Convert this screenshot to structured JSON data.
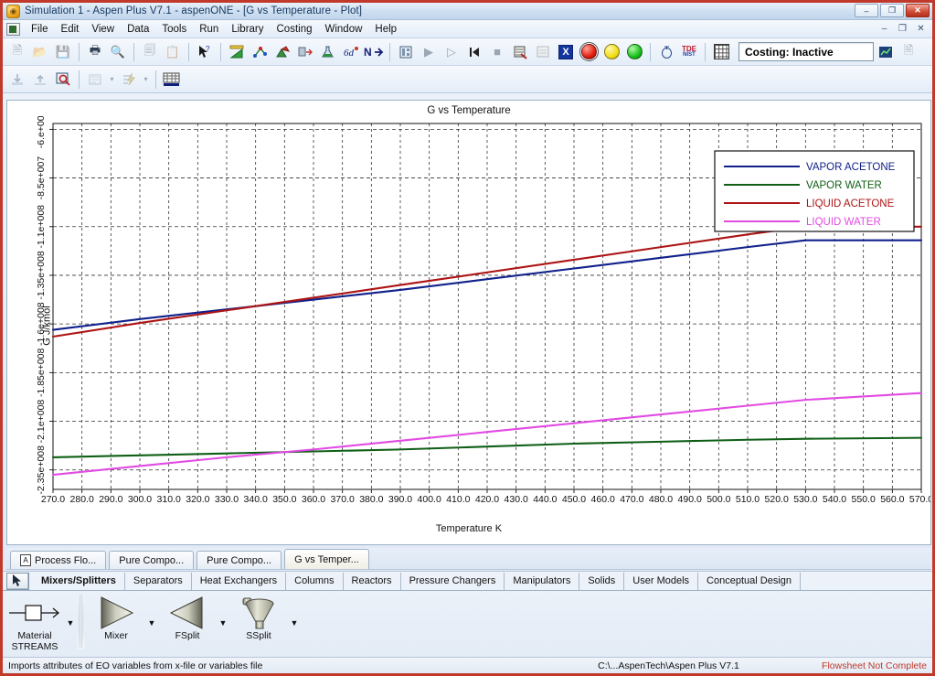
{
  "window": {
    "title": "Simulation 1 - Aspen Plus V7.1 - aspenONE - [G vs Temperature - Plot]",
    "app_icon": "aspen-icon",
    "minimize": "–",
    "maximize": "❐",
    "close": "✕",
    "mdi_minimize": "–",
    "mdi_restore": "❐",
    "mdi_close": "✕"
  },
  "menu": {
    "items": [
      {
        "label": "File"
      },
      {
        "label": "Edit"
      },
      {
        "label": "View"
      },
      {
        "label": "Data"
      },
      {
        "label": "Tools"
      },
      {
        "label": "Run"
      },
      {
        "label": "Library"
      },
      {
        "label": "Costing"
      },
      {
        "label": "Window"
      },
      {
        "label": "Help"
      }
    ]
  },
  "toolbar": {
    "costing_status": "Costing: Inactive",
    "buttons": [
      {
        "name": "new-icon",
        "glyph": "🗎"
      },
      {
        "name": "open-icon",
        "glyph": "📂"
      },
      {
        "name": "save-icon",
        "glyph": "💾"
      },
      {
        "name": "print-icon",
        "glyph": "🖶"
      },
      {
        "name": "print-preview-icon",
        "glyph": "🔍"
      },
      {
        "name": "copy-icon",
        "glyph": "🗐"
      },
      {
        "name": "paste-icon",
        "glyph": "📋"
      },
      {
        "name": "help-pointer-icon",
        "glyph": "❖"
      },
      {
        "name": "plot-wizard-icon",
        "glyph": "📈"
      },
      {
        "name": "stream-table-icon",
        "glyph": "✛"
      },
      {
        "name": "reconcile-icon",
        "glyph": "⛰"
      },
      {
        "name": "data-fit-icon",
        "glyph": "⇥"
      },
      {
        "name": "analysis-icon",
        "glyph": "⚗"
      },
      {
        "name": "binary-analysis-icon",
        "glyph": "6d"
      },
      {
        "name": "next-input-icon",
        "glyph": "N▸"
      },
      {
        "name": "control-panel-icon",
        "glyph": "▤"
      },
      {
        "name": "run-icon",
        "glyph": "▶"
      },
      {
        "name": "step-icon",
        "glyph": "▷"
      },
      {
        "name": "reinitialize-icon",
        "glyph": "◀|"
      },
      {
        "name": "stop-icon",
        "glyph": "■"
      },
      {
        "name": "results-icon",
        "glyph": "▥"
      },
      {
        "name": "report-icon",
        "glyph": "▨"
      },
      {
        "name": "excel-export-icon",
        "glyph": "X"
      },
      {
        "name": "status-red-icon",
        "glyph": ""
      },
      {
        "name": "status-yellow-icon",
        "glyph": ""
      },
      {
        "name": "status-green-icon",
        "glyph": ""
      },
      {
        "name": "properties-icon",
        "glyph": "⌬"
      },
      {
        "name": "tde-nist-icon",
        "glyph": "TDE"
      },
      {
        "name": "grid-icon",
        "glyph": "▦"
      }
    ],
    "row2_buttons": [
      {
        "name": "import-icon",
        "glyph": "⇩"
      },
      {
        "name": "export-icon",
        "glyph": "⇧"
      },
      {
        "name": "zoom-icon",
        "glyph": "🔍"
      },
      {
        "name": "form-icon",
        "glyph": "▤"
      },
      {
        "name": "form-caret-icon",
        "glyph": "▾"
      },
      {
        "name": "lightning-icon",
        "glyph": "⚡"
      },
      {
        "name": "lightning-caret-icon",
        "glyph": "▾"
      },
      {
        "name": "table-view-icon",
        "glyph": "▦"
      }
    ]
  },
  "chart_data": {
    "type": "line",
    "title": "G vs Temperature",
    "xlabel": "Temperature  K",
    "ylabel": "G J/kmol",
    "xlim": [
      270.0,
      570.0
    ],
    "ylim": [
      -245000000,
      -57000000
    ],
    "grid": true,
    "legend_position": "top-right",
    "xticks": [
      "270.0",
      "280.0",
      "290.0",
      "300.0",
      "310.0",
      "320.0",
      "330.0",
      "340.0",
      "350.0",
      "360.0",
      "370.0",
      "380.0",
      "390.0",
      "400.0",
      "410.0",
      "420.0",
      "430.0",
      "440.0",
      "450.0",
      "460.0",
      "470.0",
      "480.0",
      "490.0",
      "500.0",
      "510.0",
      "520.0",
      "530.0",
      "540.0",
      "550.0",
      "560.0",
      "570.0"
    ],
    "yticks": [
      "-2.35e+008",
      "-2.1e+008",
      "-1.85e+008",
      "-1.6e+008",
      "-1.35e+008",
      "-1.1e+008",
      "-8.5e+007",
      "-6.e+007"
    ],
    "ytick_values": [
      -235000000,
      -210000000,
      -185000000,
      -160000000,
      -135000000,
      -110000000,
      -85000000,
      -60000000
    ],
    "x": [
      270,
      300,
      330,
      360,
      390,
      420,
      450,
      480,
      510,
      530,
      570
    ],
    "series": [
      {
        "name": "VAPOR ACETONE",
        "color": "#10218b",
        "values": [
          -163000000,
          -157500000,
          -152500000,
          -147500000,
          -142500000,
          -137000000,
          -131500000,
          -126000000,
          -120500000,
          -117000000,
          -117000000
        ]
      },
      {
        "name": "VAPOR WATER",
        "color": "#0f5f16",
        "values": [
          -228500000,
          -227500000,
          -226500000,
          -225500000,
          -224500000,
          -223000000,
          -221500000,
          -220500000,
          -219500000,
          -219000000,
          -218500000
        ]
      },
      {
        "name": "LIQUID ACETONE",
        "color": "#ad1414",
        "values": [
          -166500000,
          -159500000,
          -153000000,
          -146500000,
          -140000000,
          -133500000,
          -127000000,
          -120500000,
          -114000000,
          -110000000,
          -110000000
        ]
      },
      {
        "name": "LIQUID WATER",
        "color": "#e24be2",
        "values": [
          -237500000,
          -233000000,
          -228500000,
          -224500000,
          -220000000,
          -215500000,
          -211000000,
          -206500000,
          -202000000,
          -199000000,
          -195500000
        ]
      }
    ]
  },
  "window_tabs": [
    {
      "label": "Process Flo...",
      "icon": "flowsheet-icon",
      "active": false
    },
    {
      "label": "Pure Compo...",
      "icon": "",
      "active": false
    },
    {
      "label": "Pure Compo...",
      "icon": "",
      "active": false
    },
    {
      "label": "G vs Temper...",
      "icon": "",
      "active": true
    }
  ],
  "palette": {
    "tabs": [
      {
        "label": "Mixers/Splitters",
        "active": true
      },
      {
        "label": "Separators",
        "active": false
      },
      {
        "label": "Heat Exchangers",
        "active": false
      },
      {
        "label": "Columns",
        "active": false
      },
      {
        "label": "Reactors",
        "active": false
      },
      {
        "label": "Pressure Changers",
        "active": false
      },
      {
        "label": "Manipulators",
        "active": false
      },
      {
        "label": "Solids",
        "active": false
      },
      {
        "label": "User Models",
        "active": false
      },
      {
        "label": "Conceptual Design",
        "active": false
      }
    ],
    "select_tool": "arrow-select-tool",
    "items": [
      {
        "name": "material-streams",
        "caption_line1": "Material",
        "caption_line2": "STREAMS",
        "icon": "stream-arrow-icon"
      },
      {
        "name": "mixer",
        "caption_line1": "",
        "caption_line2": "Mixer",
        "icon": "mixer-triangle-icon"
      },
      {
        "name": "fsplit",
        "caption_line1": "",
        "caption_line2": "FSplit",
        "icon": "fsplit-triangle-icon"
      },
      {
        "name": "ssplit",
        "caption_line1": "",
        "caption_line2": "SSplit",
        "icon": "ssplit-vessel-icon"
      }
    ],
    "caret": "▼"
  },
  "statusbar": {
    "hint": "Imports attributes of EO variables from x-file or variables file",
    "path": "C:\\...AspenTech\\Aspen Plus V7.1",
    "flowsheet_status": "Flowsheet Not Complete"
  }
}
